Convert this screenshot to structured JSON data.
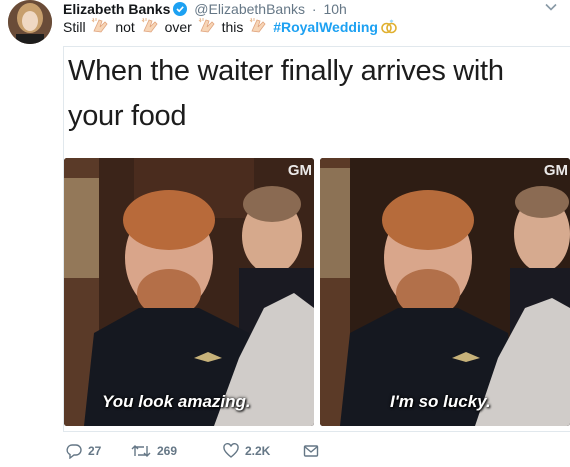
{
  "tweet": {
    "author_name": "Elizabeth Banks",
    "handle": "@ElizabethBanks",
    "separator": "·",
    "time": "10h",
    "text_parts": [
      "Still",
      "not",
      "over",
      "this"
    ],
    "hashtag": "#RoyalWedding"
  },
  "media": {
    "caption": "When the waiter finally arrives with your food",
    "panel1_subtitle": "You look amazing.",
    "panel2_subtitle": "I'm so lucky.",
    "watermark": "GM"
  },
  "actions": {
    "replies": "27",
    "retweets": "269",
    "likes": "2.2K"
  },
  "colors": {
    "accent": "#1da1f2",
    "text": "#14171a",
    "muted": "#657786"
  },
  "icons": [
    "clapping-hands-icon",
    "rings-icon",
    "reply-icon",
    "retweet-icon",
    "like-icon",
    "message-icon",
    "chevron-down-icon",
    "verified-badge-icon"
  ]
}
